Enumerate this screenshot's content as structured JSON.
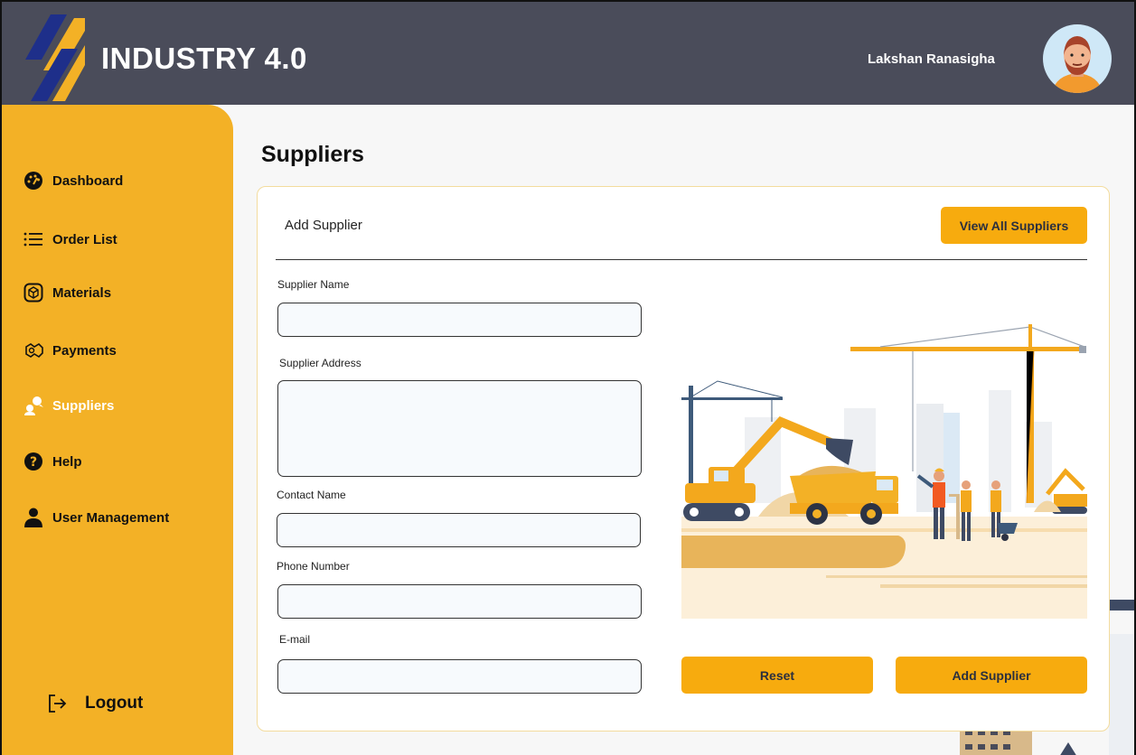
{
  "header": {
    "brand": "INDUSTRY 4.0",
    "user_name": "Lakshan Ranasigha"
  },
  "sidebar": {
    "items": [
      {
        "label": "Dashboard",
        "icon": "gauge-icon"
      },
      {
        "label": "Order List",
        "icon": "list-icon"
      },
      {
        "label": "Materials",
        "icon": "box-icon"
      },
      {
        "label": "Payments",
        "icon": "money-icon"
      },
      {
        "label": "Suppliers",
        "icon": "suppliers-icon",
        "active": true
      },
      {
        "label": "Help",
        "icon": "help-icon"
      },
      {
        "label": "User Management",
        "icon": "user-icon"
      }
    ],
    "logout": "Logout"
  },
  "main": {
    "page_title": "Suppliers",
    "card_title": "Add Supplier",
    "view_all": "View All Suppliers",
    "fields": {
      "supplier_name": {
        "label": "Supplier Name",
        "value": ""
      },
      "supplier_address": {
        "label": "Supplier Address",
        "value": ""
      },
      "contact_name": {
        "label": "Contact Name",
        "value": ""
      },
      "phone_number": {
        "label": "Phone Number",
        "value": ""
      },
      "email": {
        "label": "E-mail",
        "value": ""
      }
    },
    "reset_label": "Reset",
    "add_label": "Add Supplier"
  },
  "colors": {
    "header": "#4a4c5a",
    "sidebar": "#f3b126",
    "accent_button": "#f7ab0e",
    "active_nav_text": "#ffffff"
  }
}
